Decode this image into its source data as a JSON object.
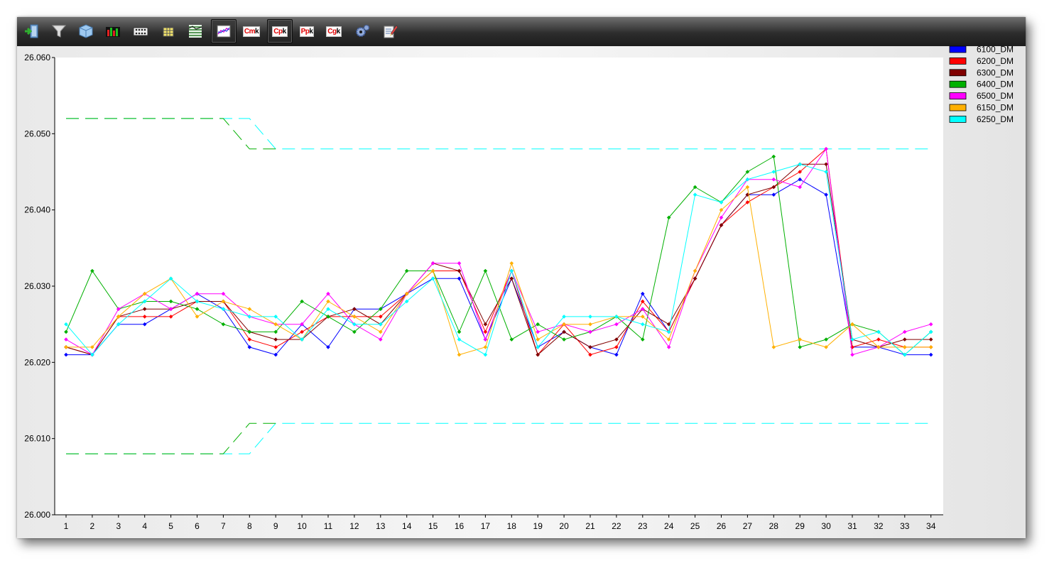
{
  "toolbar": {
    "buttons": [
      {
        "id": "exit",
        "icon": "exit-door-icon"
      },
      {
        "id": "filter",
        "icon": "funnel-filter-icon"
      },
      {
        "id": "cube",
        "icon": "cube-icon"
      },
      {
        "id": "bars",
        "icon": "colored-bars-icon"
      },
      {
        "id": "dots",
        "icon": "dot-matrix-icon"
      },
      {
        "id": "table",
        "icon": "table-grid-icon"
      },
      {
        "id": "lines",
        "icon": "stacked-lines-icon"
      },
      {
        "id": "trend",
        "icon": "trend-chart-icon",
        "active": true
      },
      {
        "id": "cmk",
        "label": "Cm",
        "sub": "k"
      },
      {
        "id": "cpk",
        "label": "Cp",
        "sub": "k",
        "active": true
      },
      {
        "id": "ppk",
        "label": "Pp",
        "sub": "k"
      },
      {
        "id": "cgk",
        "label": "Cg",
        "sub": "k"
      },
      {
        "id": "settings",
        "icon": "gears-icon"
      },
      {
        "id": "report",
        "icon": "edit-note-icon"
      }
    ]
  },
  "chart_data": {
    "type": "line",
    "categories": [
      "1",
      "2",
      "3",
      "4",
      "5",
      "6",
      "7",
      "8",
      "9",
      "10",
      "11",
      "12",
      "13",
      "14",
      "15",
      "16",
      "17",
      "18",
      "19",
      "20",
      "21",
      "22",
      "23",
      "24",
      "25",
      "26",
      "27",
      "28",
      "29",
      "30",
      "31",
      "32",
      "33",
      "34"
    ],
    "y_ticks": [
      "26.000",
      "26.010",
      "26.020",
      "26.030",
      "26.040",
      "26.050",
      "26.060"
    ],
    "ylim": [
      26.0,
      26.06
    ],
    "legend_position": "top-right",
    "series": [
      {
        "name": "6100_DM",
        "color": "#0000ff",
        "values": [
          26.021,
          26.021,
          26.025,
          26.025,
          26.027,
          26.029,
          26.027,
          26.022,
          26.021,
          26.025,
          26.022,
          26.027,
          26.027,
          26.029,
          26.031,
          26.031,
          26.023,
          26.031,
          26.022,
          26.024,
          26.022,
          26.021,
          26.029,
          26.024,
          26.031,
          26.038,
          26.042,
          26.042,
          26.044,
          26.042,
          26.022,
          26.022,
          26.021,
          26.021
        ]
      },
      {
        "name": "6200_DM",
        "color": "#ff0000",
        "values": [
          26.022,
          26.021,
          26.026,
          26.026,
          26.026,
          26.028,
          26.028,
          26.023,
          26.022,
          26.024,
          26.026,
          26.026,
          26.026,
          26.029,
          26.032,
          26.032,
          26.024,
          26.032,
          26.021,
          26.025,
          26.021,
          26.022,
          26.028,
          26.024,
          26.031,
          26.038,
          26.041,
          26.043,
          26.045,
          26.048,
          26.022,
          26.023,
          26.022,
          26.022
        ]
      },
      {
        "name": "6300_DM",
        "color": "#800000",
        "values": [
          26.022,
          26.021,
          26.026,
          26.027,
          26.027,
          26.028,
          26.028,
          26.024,
          26.023,
          26.023,
          26.026,
          26.027,
          26.025,
          26.029,
          26.033,
          26.032,
          26.025,
          26.031,
          26.021,
          26.024,
          26.022,
          26.023,
          26.027,
          26.025,
          26.031,
          26.038,
          26.042,
          26.043,
          26.046,
          26.046,
          26.023,
          26.022,
          26.023,
          26.023
        ]
      },
      {
        "name": "6400_DM",
        "color": "#00b000",
        "values": [
          26.024,
          26.032,
          26.027,
          26.028,
          26.028,
          26.027,
          26.025,
          26.024,
          26.024,
          26.028,
          26.026,
          26.024,
          26.027,
          26.032,
          26.032,
          26.024,
          26.032,
          26.023,
          26.025,
          26.023,
          26.024,
          26.026,
          26.023,
          26.039,
          26.043,
          26.041,
          26.045,
          26.047,
          26.022,
          26.023,
          26.025,
          26.024,
          26.021,
          26.024
        ]
      },
      {
        "name": "6500_DM",
        "color": "#ff00ff",
        "values": [
          26.023,
          26.021,
          26.027,
          26.029,
          26.027,
          26.029,
          26.029,
          26.026,
          26.025,
          26.025,
          26.029,
          26.025,
          26.023,
          26.029,
          26.033,
          26.033,
          26.023,
          26.032,
          26.024,
          26.025,
          26.024,
          26.025,
          26.027,
          26.022,
          26.032,
          26.039,
          26.044,
          26.044,
          26.043,
          26.048,
          26.021,
          26.022,
          26.024,
          26.025
        ]
      },
      {
        "name": "6150_DM",
        "color": "#ffb000",
        "values": [
          26.022,
          26.022,
          26.026,
          26.029,
          26.031,
          26.026,
          26.028,
          26.027,
          26.025,
          26.023,
          26.028,
          26.026,
          26.024,
          26.029,
          26.032,
          26.021,
          26.022,
          26.033,
          26.023,
          26.025,
          26.025,
          26.026,
          26.026,
          26.023,
          26.032,
          26.04,
          26.043,
          26.022,
          26.023,
          26.022,
          26.025,
          26.022,
          26.022,
          26.022
        ]
      },
      {
        "name": "6250_DM",
        "color": "#00ffff",
        "values": [
          26.025,
          26.021,
          26.025,
          26.028,
          26.031,
          26.028,
          26.027,
          26.026,
          26.026,
          26.023,
          26.027,
          26.025,
          26.025,
          26.028,
          26.031,
          26.023,
          26.021,
          26.032,
          26.022,
          26.026,
          26.026,
          26.026,
          26.025,
          26.024,
          26.042,
          26.041,
          26.044,
          26.045,
          26.046,
          26.045,
          26.023,
          26.024,
          26.021,
          26.024
        ]
      }
    ],
    "limits": [
      {
        "kind": "upper",
        "color": "#00ffff",
        "values": [
          26.052,
          26.052,
          26.052,
          26.052,
          26.052,
          26.052,
          26.052,
          26.052,
          26.048,
          26.048,
          26.048,
          26.048,
          26.048,
          26.048,
          26.048,
          26.048,
          26.048,
          26.048,
          26.048,
          26.048,
          26.048,
          26.048,
          26.048,
          26.048,
          26.048,
          26.048,
          26.048,
          26.048,
          26.048,
          26.048,
          26.048,
          26.048,
          26.048,
          26.048
        ]
      },
      {
        "kind": "upper-alt",
        "color": "#00b000",
        "values": [
          26.052,
          26.052,
          26.052,
          26.052,
          26.052,
          26.052,
          26.052,
          26.048,
          26.048
        ]
      },
      {
        "kind": "lower",
        "color": "#00ffff",
        "values": [
          26.008,
          26.008,
          26.008,
          26.008,
          26.008,
          26.008,
          26.008,
          26.008,
          26.012,
          26.012,
          26.012,
          26.012,
          26.012,
          26.012,
          26.012,
          26.012,
          26.012,
          26.012,
          26.012,
          26.012,
          26.012,
          26.012,
          26.012,
          26.012,
          26.012,
          26.012,
          26.012,
          26.012,
          26.012,
          26.012,
          26.012,
          26.012,
          26.012,
          26.012
        ]
      },
      {
        "kind": "lower-alt",
        "color": "#00b000",
        "values": [
          26.008,
          26.008,
          26.008,
          26.008,
          26.008,
          26.008,
          26.008,
          26.012,
          26.012
        ]
      }
    ]
  }
}
